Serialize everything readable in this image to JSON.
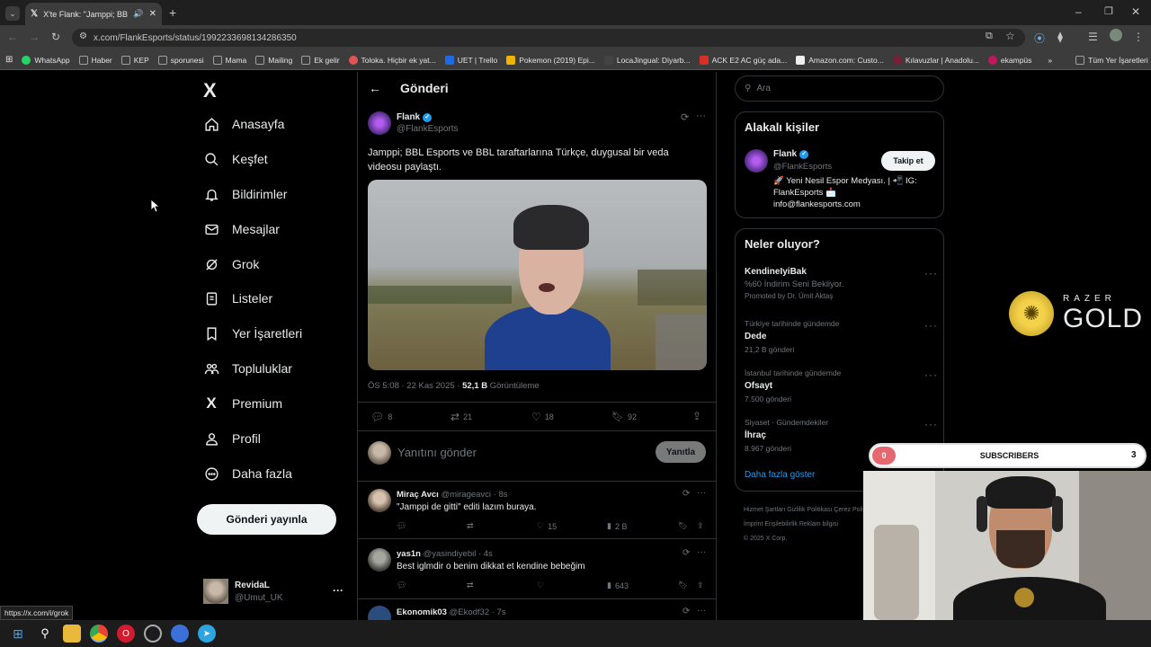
{
  "browser": {
    "tab_title": "X'te Flank: \"Jamppi; BBL Esp...",
    "url": "x.com/FlankEsports/status/1992233698134286350",
    "status_url": "https://x.com/i/grok",
    "bookmarks": [
      "WhatsApp",
      "Haber",
      "KEP",
      "sporunesi",
      "Mama",
      "Mailing",
      "Ek gelir",
      "Toloka. Hiçbir ek yat...",
      "UET | Trello",
      "Pokemon (2019) Epi...",
      "LocaJingual: Diyarb...",
      "ACK E2 AC güç ada...",
      "Amazon.com: Custo...",
      "Kılavuzlar | Anadolu...",
      "ekampüs",
      "»",
      "Tüm Yer İşaretleri"
    ],
    "bookmark_colors": [
      "#25d366",
      "#9aa0a6",
      "#9aa0a6",
      "#9aa0a6",
      "#9aa0a6",
      "#9aa0a6",
      "#9aa0a6",
      "#e05454",
      "#1d6ae5",
      "#f0b400",
      "#444444",
      "#d93025",
      "#eeeeee",
      "#7b1e3a",
      "#c2185b",
      "#e3e3e3",
      "#9aa0a6"
    ]
  },
  "nav": {
    "logo": "X",
    "items": [
      {
        "label": "Anasayfa",
        "icon": "home-icon"
      },
      {
        "label": "Keşfet",
        "icon": "search-icon"
      },
      {
        "label": "Bildirimler",
        "icon": "bell-icon"
      },
      {
        "label": "Mesajlar",
        "icon": "mail-icon"
      },
      {
        "label": "Grok",
        "icon": "grok-icon"
      },
      {
        "label": "Listeler",
        "icon": "list-icon"
      },
      {
        "label": "Yer İşaretleri",
        "icon": "bookmark-icon"
      },
      {
        "label": "Topluluklar",
        "icon": "communities-icon"
      },
      {
        "label": "Premium",
        "icon": "x-icon"
      },
      {
        "label": "Profil",
        "icon": "person-icon"
      },
      {
        "label": "Daha fazla",
        "icon": "more-circle-icon"
      }
    ],
    "post_button": "Gönderi yayınla",
    "account": {
      "name": "RevidaL",
      "handle": "@Umut_UK",
      "more": "···"
    }
  },
  "main": {
    "header": "Gönderi",
    "post": {
      "name": "Flank",
      "handle": "@FlankEsports",
      "text": "Jamppi; BBL Esports ve BBL taraftarlarına Türkçe, duygusal bir veda videosu paylaştı.",
      "time": "ÖS 5:08 · 22 Kas 2025 · ",
      "views": "52,1 B",
      "views_label": " Görüntüleme",
      "replies": "8",
      "reposts": "21",
      "likes": "18",
      "bookmarks": "92"
    },
    "reply_box": {
      "placeholder": "Yanıtını gönder",
      "button": "Yanıtla"
    },
    "replies": [
      {
        "name": "Miraç Avcı",
        "handle": "@mirageavci · 8s",
        "text": "\"Jamppi de gitti\" editi lazım buraya.",
        "likes": "15",
        "views": "2 B"
      },
      {
        "name": "yas1n",
        "handle": "@yasindiyebil · 4s",
        "text": "Best iglmdir o benim dikkat et kendine bebeğim",
        "likes": "",
        "views": "643"
      },
      {
        "name": "Ekonomik03",
        "handle": "@Ekodf32 · 7s",
        "text": "",
        "likes": "",
        "views": ""
      }
    ]
  },
  "sidebar": {
    "search_placeholder": "Ara",
    "people": {
      "title": "Alakalı kişiler",
      "name": "Flank",
      "handle": "@FlankEsports",
      "follow": "Takip et",
      "bio1": "🚀 Yeni Nesil Espor Medyası. | 📲 IG:",
      "bio2": "FlankEsports 📩",
      "bio3": "info@flankesports.com"
    },
    "trends": {
      "title": "Neler oluyor?",
      "items": [
        {
          "a": "KendineIyiBak",
          "b": "%60 İndirim Seni Bekliyor.",
          "c": "Promoted by Dr. Ümit Aktaş"
        },
        {
          "a": "Türkiye tarihinde gündemde",
          "b": "Dede",
          "c": "21,2 B gönderi"
        },
        {
          "a": "İstanbul tarihinde gündemde",
          "b": "Ofsayt",
          "c": "7.500 gönderi"
        },
        {
          "a": "Siyaset · Gündemdekiler",
          "b": "İhraç",
          "c": "8.967 gönderi"
        }
      ],
      "more": "Daha fazla göster"
    },
    "footer1": "Hizmet Şartları   Gizlilik Politikası   Çerez Politikası",
    "footer2": "İmprint   Erişilebilirlik   Reklam bilgisi",
    "footer3": "© 2025 X Corp."
  },
  "overlay": {
    "razer_top": "RAZER",
    "razer_gold": "GOLD",
    "subs_left": "0",
    "subs_label": "SUBSCRIBERS",
    "subs_right": "3"
  },
  "colors": {
    "accent": "#1d9bf0",
    "bg": "#000000",
    "border": "#2f3336"
  }
}
